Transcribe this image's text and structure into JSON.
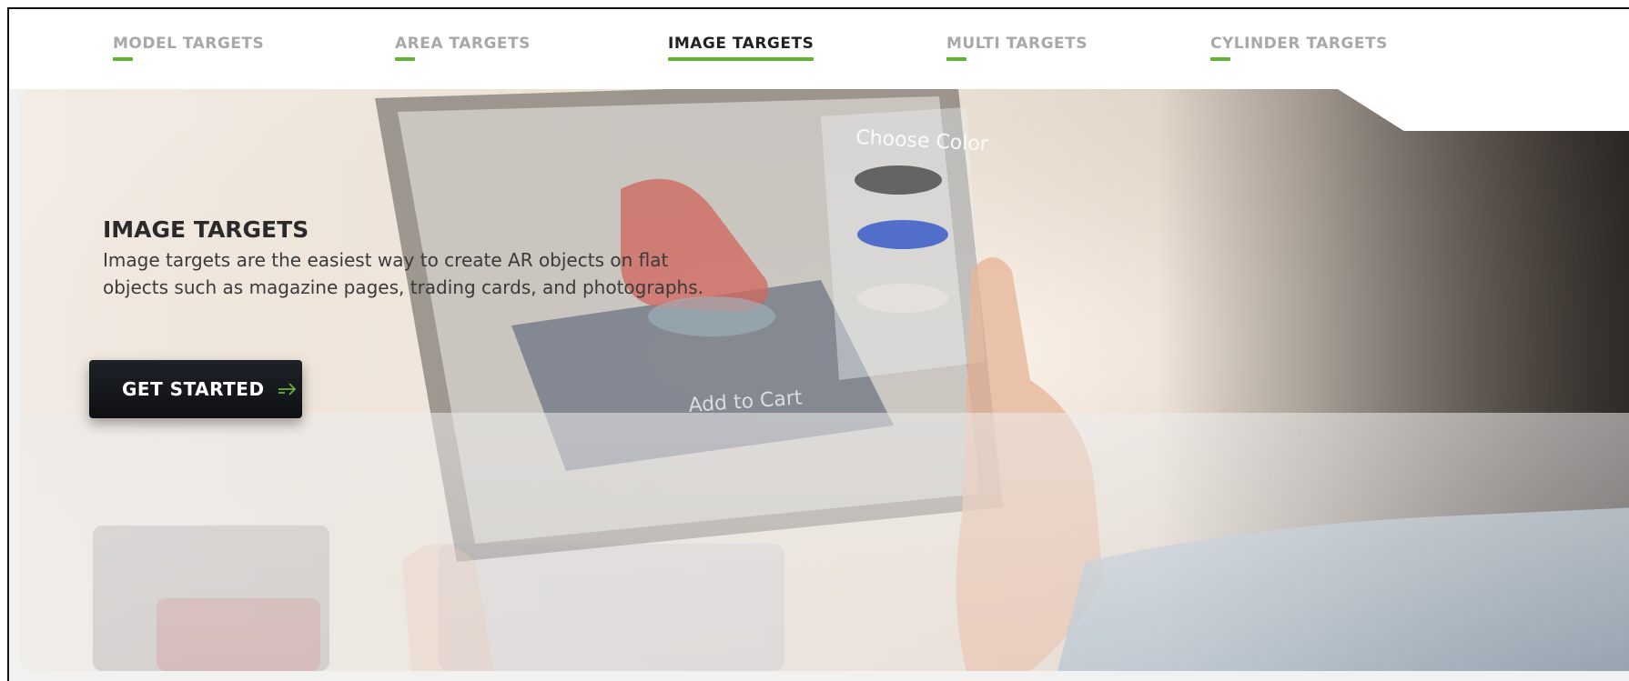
{
  "tabs": [
    {
      "label": "MODEL TARGETS",
      "active": false
    },
    {
      "label": "AREA TARGETS",
      "active": false
    },
    {
      "label": "IMAGE TARGETS",
      "active": true
    },
    {
      "label": "MULTI TARGETS",
      "active": false
    },
    {
      "label": "CYLINDER TARGETS",
      "active": false
    }
  ],
  "hero": {
    "title": "IMAGE TARGETS",
    "description": "Image targets are the easiest way to create AR objects on flat objects such as magazine pages, trading cards, and photographs.",
    "cta_label": "GET STARTED",
    "cta_icon": "arrow-right-icon",
    "image_texts": {
      "choose_color": "Choose Color",
      "add_to_cart": "Add to Cart"
    }
  },
  "colors": {
    "accent": "#5fb332",
    "tab_inactive": "#a8a8a8",
    "tab_active": "#222222",
    "button_bg": "#111418"
  }
}
